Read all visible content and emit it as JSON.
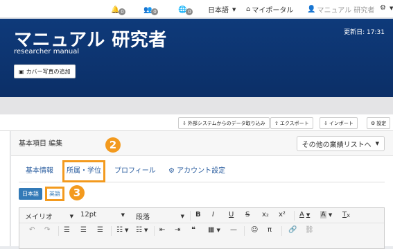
{
  "topbar": {
    "notif1": "0",
    "notif2": "0",
    "notif3": "0",
    "language": "日本語",
    "my_portal": "マイポータル",
    "user": "マニュアル 研究者"
  },
  "hero": {
    "title": "マニュアル 研究者",
    "subtitle": "researcher manual",
    "updated": "更新日: 17:31",
    "cover_button": "カバー写真の追加"
  },
  "actions": {
    "import_external": "外部システムからのデータ取り込み",
    "export": "エクスポート",
    "import": "インポート",
    "settings": "設定"
  },
  "panel": {
    "title": "基本項目 編集",
    "other_list": "その他の業績リストへ",
    "tabs": [
      "基本情報",
      "所属・学位",
      "プロフィール",
      "アカウント設定"
    ],
    "lang_ja": "日本語",
    "lang_en": "英語"
  },
  "steps": {
    "step2": "2",
    "step3": "3"
  },
  "editor": {
    "font": "メイリオ",
    "size": "12pt",
    "format": "段落",
    "bold": "B",
    "italic": "I",
    "underline": "U",
    "strike": "S",
    "subscript": "x₂",
    "superscript": "x²",
    "font_color": "A",
    "bg_color": "A",
    "clear": "T",
    "pi": "π"
  },
  "colors": {
    "accent": "#f39a1e",
    "brand": "#0c2f67",
    "link": "#2a5d9f",
    "primary": "#337ab7"
  }
}
